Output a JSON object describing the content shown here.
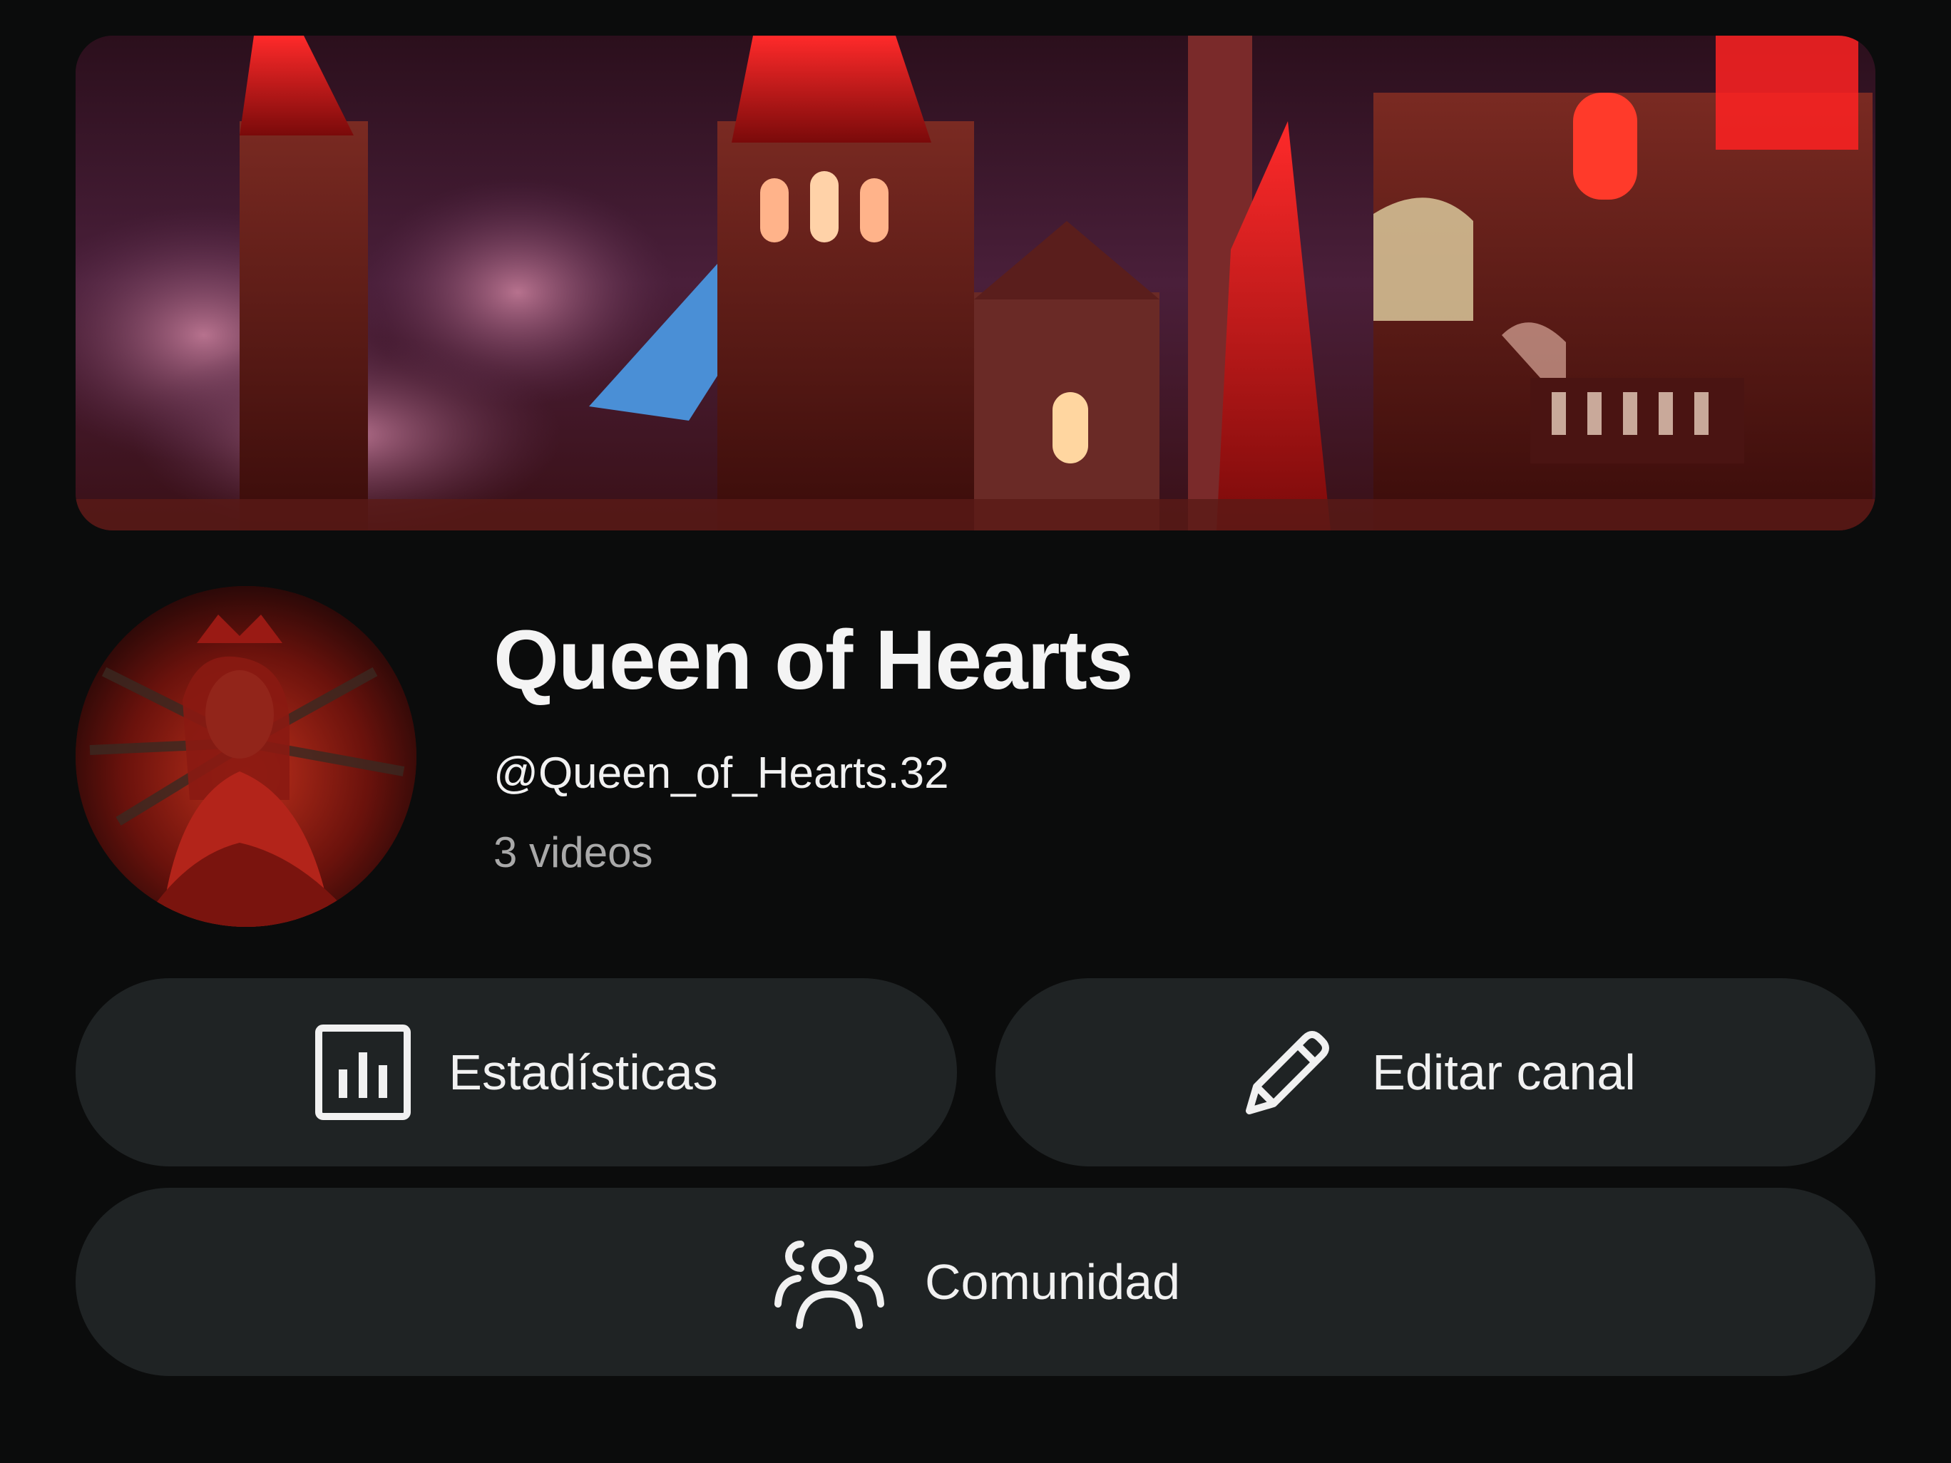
{
  "channel": {
    "name": "Queen of Hearts",
    "handle": "@Queen_of_Hearts.32",
    "video_count": "3 videos"
  },
  "banner": {
    "description_icon": "castle-banner-image"
  },
  "avatar": {
    "icon": "avatar-image"
  },
  "actions": {
    "stats_label": "Estadísticas",
    "stats_icon": "bar-chart-icon",
    "edit_label": "Editar canal",
    "edit_icon": "pencil-icon",
    "community_label": "Comunidad",
    "community_icon": "people-icon"
  },
  "colors": {
    "background": "#0b0c0c",
    "button_bg": "#1f2324",
    "text_primary": "#f1f1f1",
    "text_secondary": "#a9a9a9"
  }
}
